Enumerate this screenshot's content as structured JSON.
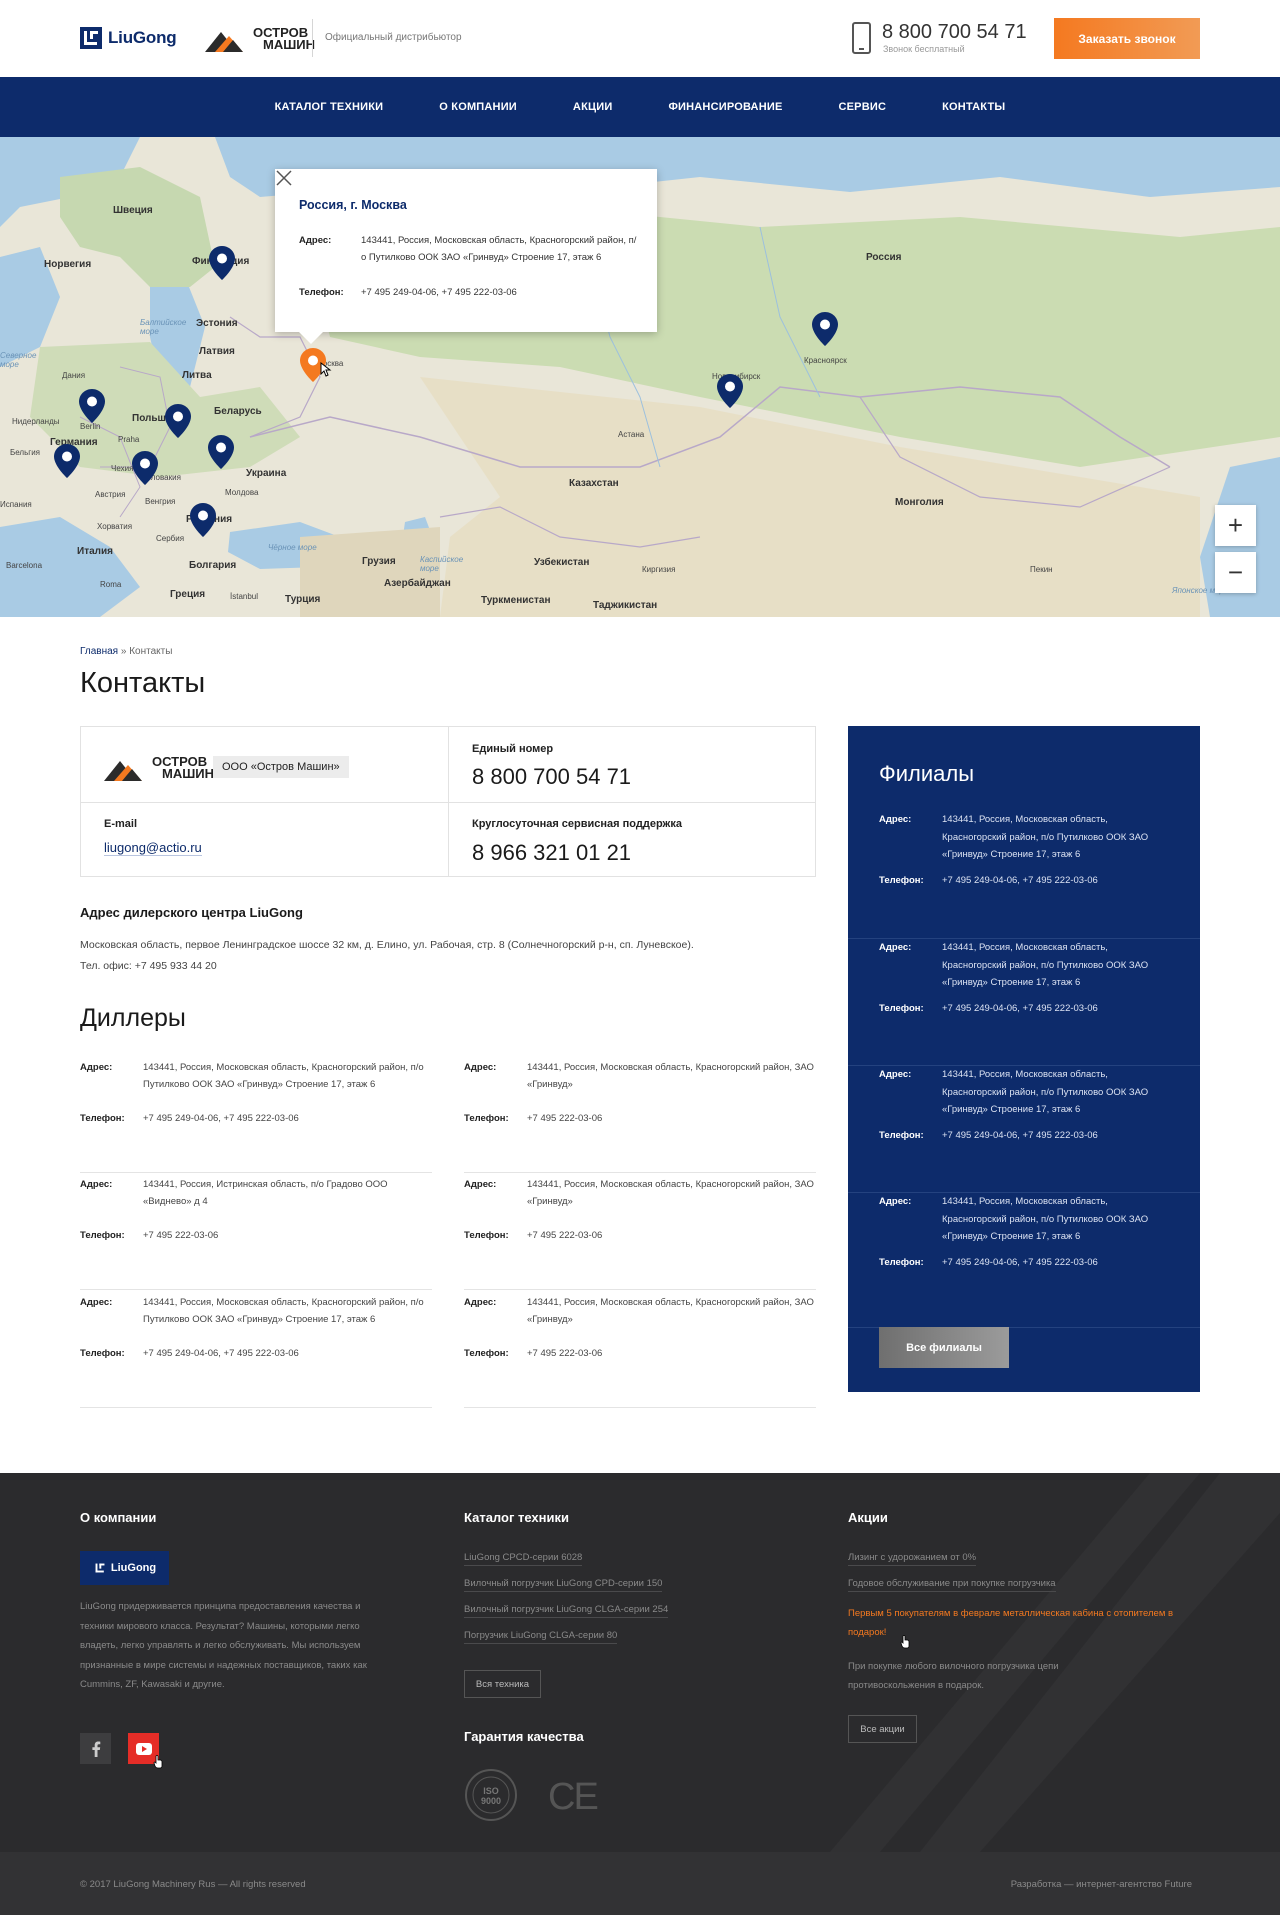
{
  "header": {
    "brand": "LiuGong",
    "partner_line1": "ОСТРОВ",
    "partner_line2": "МАШИН",
    "tagline": "Официальный дистрибьютор",
    "phone": "8 800 700 54 71",
    "phone_note": "Звонок бесплатный",
    "callback_label": "Заказать звонок"
  },
  "nav": {
    "items": [
      {
        "label": "КАТАЛОГ ТЕХНИКИ"
      },
      {
        "label": "О КОМПАНИИ"
      },
      {
        "label": "АКЦИИ"
      },
      {
        "label": "ФИНАНСИРОВАНИЕ"
      },
      {
        "label": "СЕРВИС"
      },
      {
        "label": "КОНТАКТЫ"
      }
    ]
  },
  "map": {
    "popup": {
      "title": "Россия, г. Москва",
      "address_label": "Адрес:",
      "address": "143441, Россия, Московская область, Красногорский район, п/о Путилково ООК ЗАО «Гринвуд» Строение 17, этаж 6",
      "phone_label": "Телефон:",
      "phone": "+7 495 249-04-06, +7 495 222-03-06"
    },
    "labels": {
      "sweden": "Швеция",
      "norway": "Норвегия",
      "finland": "Финляндия",
      "estonia": "Эстония",
      "latvia": "Латвия",
      "lithuania": "Литва",
      "belarus": "Беларусь",
      "russia": "Россия",
      "denmark": "Дания",
      "germany": "Германия",
      "poland": "Польша",
      "ukraine": "Украина",
      "kazakhstan": "Казахстан",
      "mongolia": "Монголия",
      "uzbekistan": "Узбекистан",
      "turkmenistan": "Туркменистан",
      "tajikistan": "Таджикистан",
      "kyrgyzstan": "Киргизия",
      "georgia": "Грузия",
      "azerbaijan": "Азербайджан",
      "turkey": "Турция",
      "greece": "Греция",
      "bulgaria": "Болгария",
      "italy": "Италия",
      "romania": "Румыния",
      "serbia": "Сербия",
      "croatia": "Хорватия",
      "hungary": "Венгрия",
      "austria": "Австрия",
      "slovakia": "Словакия",
      "czech": "Чехия",
      "moldova": "Молдова",
      "netherlands": "Нидерланды",
      "belgium": "Бельгия",
      "spain": "Испания",
      "berlin": "Berlin",
      "praha": "Praha",
      "roma": "Roma",
      "barcelona": "Barcelona",
      "istanbul": "İstanbul",
      "astana": "Астана",
      "krasnoyarsk": "Красноярск",
      "novosibirsk": "Новосибирск",
      "moscow": "Москва",
      "beijing": "Пекин",
      "baltic_sea": "Балтийское море",
      "black_sea": "Чёрное море",
      "caspian_sea": "Каспийское море",
      "sea_of_japan": "Японское море",
      "north_sea": "Северное море"
    },
    "zoom_in": "+",
    "zoom_out": "−"
  },
  "breadcrumb": {
    "home": "Главная",
    "separator": " » ",
    "current": "Контакты"
  },
  "page_title": "Контакты",
  "contacts": {
    "company_line1": "ОСТРОВ",
    "company_line2": "МАШИН",
    "company_name": "ООО «Остров Машин»",
    "single_number_label": "Единый номер",
    "single_number": "8 800 700 54 71",
    "email_label": "E-mail",
    "email": "liugong@actio.ru",
    "support_label": "Круглосуточная сервисная поддержка",
    "support_number": "8 966 321 01 21"
  },
  "dealer_center": {
    "title": "Адрес дилерского центра LiuGong",
    "address": "Московская область, первое Ленинградское шоссе 32 км, д. Елино, ул. Рабочая, стр. 8 (Солнечногорский р-н, сп. Луневское).",
    "office_phone": "Тел. офис: +7 495 933 44 20"
  },
  "dealers": {
    "title": "Диллеры",
    "address_label": "Адрес:",
    "phone_label": "Телефон:",
    "items": [
      {
        "address": "143441, Россия, Московская область, Красногорский район, п/о Путилково ООК ЗАО «Гринвуд» Строение 17, этаж 6",
        "phone": "+7 495 249-04-06, +7 495 222-03-06"
      },
      {
        "address": "143441, Россия, Московская область, Красногорский район, ЗАО «Гринвуд»",
        "phone": "+7 495 222-03-06"
      },
      {
        "address": "143441, Россия, Истринская область, п/о Градово ООО «Виднево» д 4",
        "phone": "+7 495 222-03-06"
      },
      {
        "address": "143441, Россия, Московская область, Красногорский район, ЗАО «Гринвуд»",
        "phone": "+7 495 222-03-06"
      },
      {
        "address": "143441, Россия, Московская область, Красногорский район, п/о Путилково ООК ЗАО «Гринвуд» Строение 17, этаж 6",
        "phone": "+7 495 249-04-06, +7 495 222-03-06"
      },
      {
        "address": "143441, Россия, Московская область, Красногорский район, ЗАО «Гринвуд»",
        "phone": "+7 495 222-03-06"
      }
    ]
  },
  "branches": {
    "title": "Филиалы",
    "address_label": "Адрес:",
    "phone_label": "Телефон:",
    "items": [
      {
        "address": "143441, Россия, Московская область, Красногорский район, п/о Путилково ООК ЗАО «Гринвуд» Строение 17, этаж 6",
        "phone": "+7 495 249-04-06, +7 495 222-03-06"
      },
      {
        "address": "143441, Россия, Московская область, Красногорский район, п/о Путилково ООК ЗАО «Гринвуд» Строение 17, этаж 6",
        "phone": "+7 495 249-04-06, +7 495 222-03-06"
      },
      {
        "address": "143441, Россия, Московская область, Красногорский район, п/о Путилково ООК ЗАО «Гринвуд» Строение 17, этаж 6",
        "phone": "+7 495 249-04-06, +7 495 222-03-06"
      },
      {
        "address": "143441, Россия, Московская область, Красногорский район, п/о Путилково ООК ЗАО «Гринвуд» Строение 17, этаж 6",
        "phone": "+7 495 249-04-06, +7 495 222-03-06"
      }
    ],
    "all_label": "Все филиалы"
  },
  "footer": {
    "about_title": "О компании",
    "about_logo": "LiuGong",
    "about_text": "LiuGong придерживается принципа предоставления качества и техники мирового класса. Результат? Машины, которыми легко владеть, легко управлять и легко обслуживать. Мы используем признанные в мире системы и надежных поставщиков, таких как Cummins, ZF, Kawasaki и другие.",
    "catalog_title": "Каталог техники",
    "catalog_links": [
      "LiuGong CPCD-серии 6028",
      "Вилочный погрузчик LiuGong CPD-серии 150",
      "Вилочный погрузчик LiuGong CLGA-серии 254",
      "Погрузчик LiuGong CLGA-серии 80"
    ],
    "catalog_all": "Вся техника",
    "quality_title": "Гарантия качества",
    "cert_iso": "ISO 9000",
    "cert_ce": "CE",
    "promo_title": "Акции",
    "promo_links": [
      "Лизинг с удорожанием от 0%",
      "Годовое обслуживание при покупке погрузчика"
    ],
    "promo_hot": "Первым 5 покупателям в феврале металлическая кабина с отопителем в подарок!",
    "promo_last": "При покупке любого вилочного погрузчика цепи противоскольжения в подарок.",
    "promo_all": "Все акции",
    "copyright": "© 2017  LiuGong Machinery Rus — All rights reserved",
    "dev_credit": "Разработка — интернет-агентство Future"
  },
  "colors": {
    "brand_navy": "#0d2b6b",
    "accent_orange": "#f47920",
    "footer_bg": "#2b2b2d"
  },
  "icons": [
    "phone-icon",
    "close-icon",
    "map-pin-icon",
    "facebook-icon",
    "youtube-icon",
    "cursor-icon"
  ]
}
